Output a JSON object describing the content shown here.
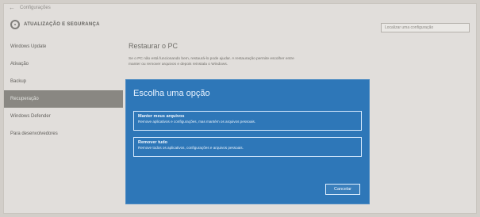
{
  "window": {
    "title_bar_text": "Configurações"
  },
  "header": {
    "title": "ATUALIZAÇÃO E SEGURANÇA",
    "search_placeholder": "Localizar uma configuração"
  },
  "sidebar": {
    "items": [
      {
        "label": "Windows Update",
        "active": false
      },
      {
        "label": "Ativação",
        "active": false
      },
      {
        "label": "Backup",
        "active": false
      },
      {
        "label": "Recuperação",
        "active": true
      },
      {
        "label": "Windows Defender",
        "active": false
      },
      {
        "label": "Para desenvolvedores",
        "active": false
      }
    ]
  },
  "main": {
    "heading": "Restaurar o PC",
    "body": "Se o PC não está funcionando bem, restaurá-lo pode ajudar. A restauração permite escolher entre manter ou remover arquivos e depois reinstala o Windows."
  },
  "dialog": {
    "title": "Escolha uma opção",
    "options": [
      {
        "title": "Manter meus arquivos",
        "description": "Remove aplicativos e configurações, mas mantém os arquivos pessoais."
      },
      {
        "title": "Remover tudo",
        "description": "Remove todos os aplicativos, configurações e arquivos pessoais."
      }
    ],
    "cancel_label": "Cancelar"
  },
  "colors": {
    "dialog_background": "#2e77b8",
    "sidebar_active": "#87857f"
  }
}
